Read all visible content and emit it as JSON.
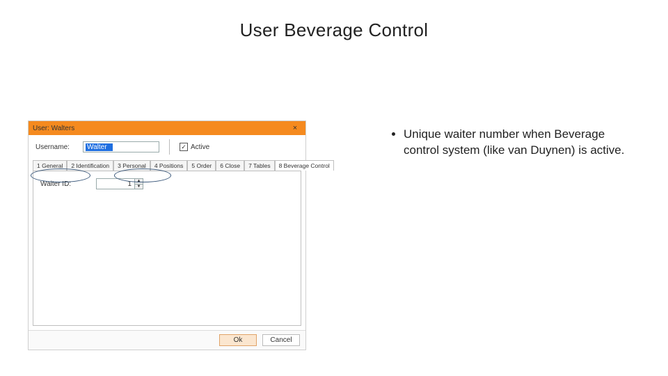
{
  "slide": {
    "title": "User Beverage Control",
    "bullet": "Unique waiter number when Beverage control system (like van Duynen) is active."
  },
  "window": {
    "title": "User: Walters",
    "close_glyph": "×",
    "username_label": "Username:",
    "username_value": "Walter",
    "active_checked_glyph": "✓",
    "active_label": "Active",
    "tabs": [
      {
        "label": "1 General"
      },
      {
        "label": "2 Identification"
      },
      {
        "label": "3 Personal"
      },
      {
        "label": "4 Positions"
      },
      {
        "label": "5 Order"
      },
      {
        "label": "6 Close"
      },
      {
        "label": "7 Tables"
      },
      {
        "label": "8 Beverage Control"
      }
    ],
    "active_tab_index": 7,
    "waiter_id_label": "Waiter ID:",
    "waiter_id_value": "1",
    "ok_label": "Ok",
    "cancel_label": "Cancel"
  }
}
